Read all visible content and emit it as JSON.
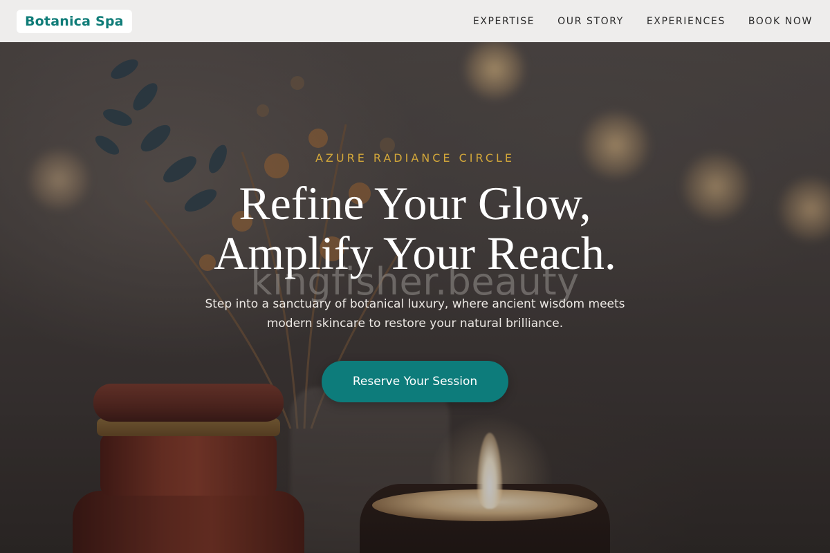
{
  "header": {
    "brand": "Botanica Spa",
    "nav": [
      {
        "label": "EXPERTISE"
      },
      {
        "label": "OUR STORY"
      },
      {
        "label": "EXPERIENCES"
      },
      {
        "label": "BOOK NOW"
      }
    ]
  },
  "hero": {
    "eyebrow": "AZURE RADIANCE CIRCLE",
    "headline_line1": "Refine Your Glow,",
    "headline_line2": "Amplify Your Reach.",
    "watermark": "kingfisher.beauty",
    "description_line1": "Step into a sanctuary of botanical luxury, where ancient wisdom meets",
    "description_line2": "modern skincare to restore your natural brilliance.",
    "cta_label": "Reserve Your Session"
  },
  "colors": {
    "brand_teal": "#0f7c78",
    "accent_gold": "#d4a83a",
    "header_bg": "#f4f3f2",
    "cta_bg": "#0d7c7b"
  }
}
